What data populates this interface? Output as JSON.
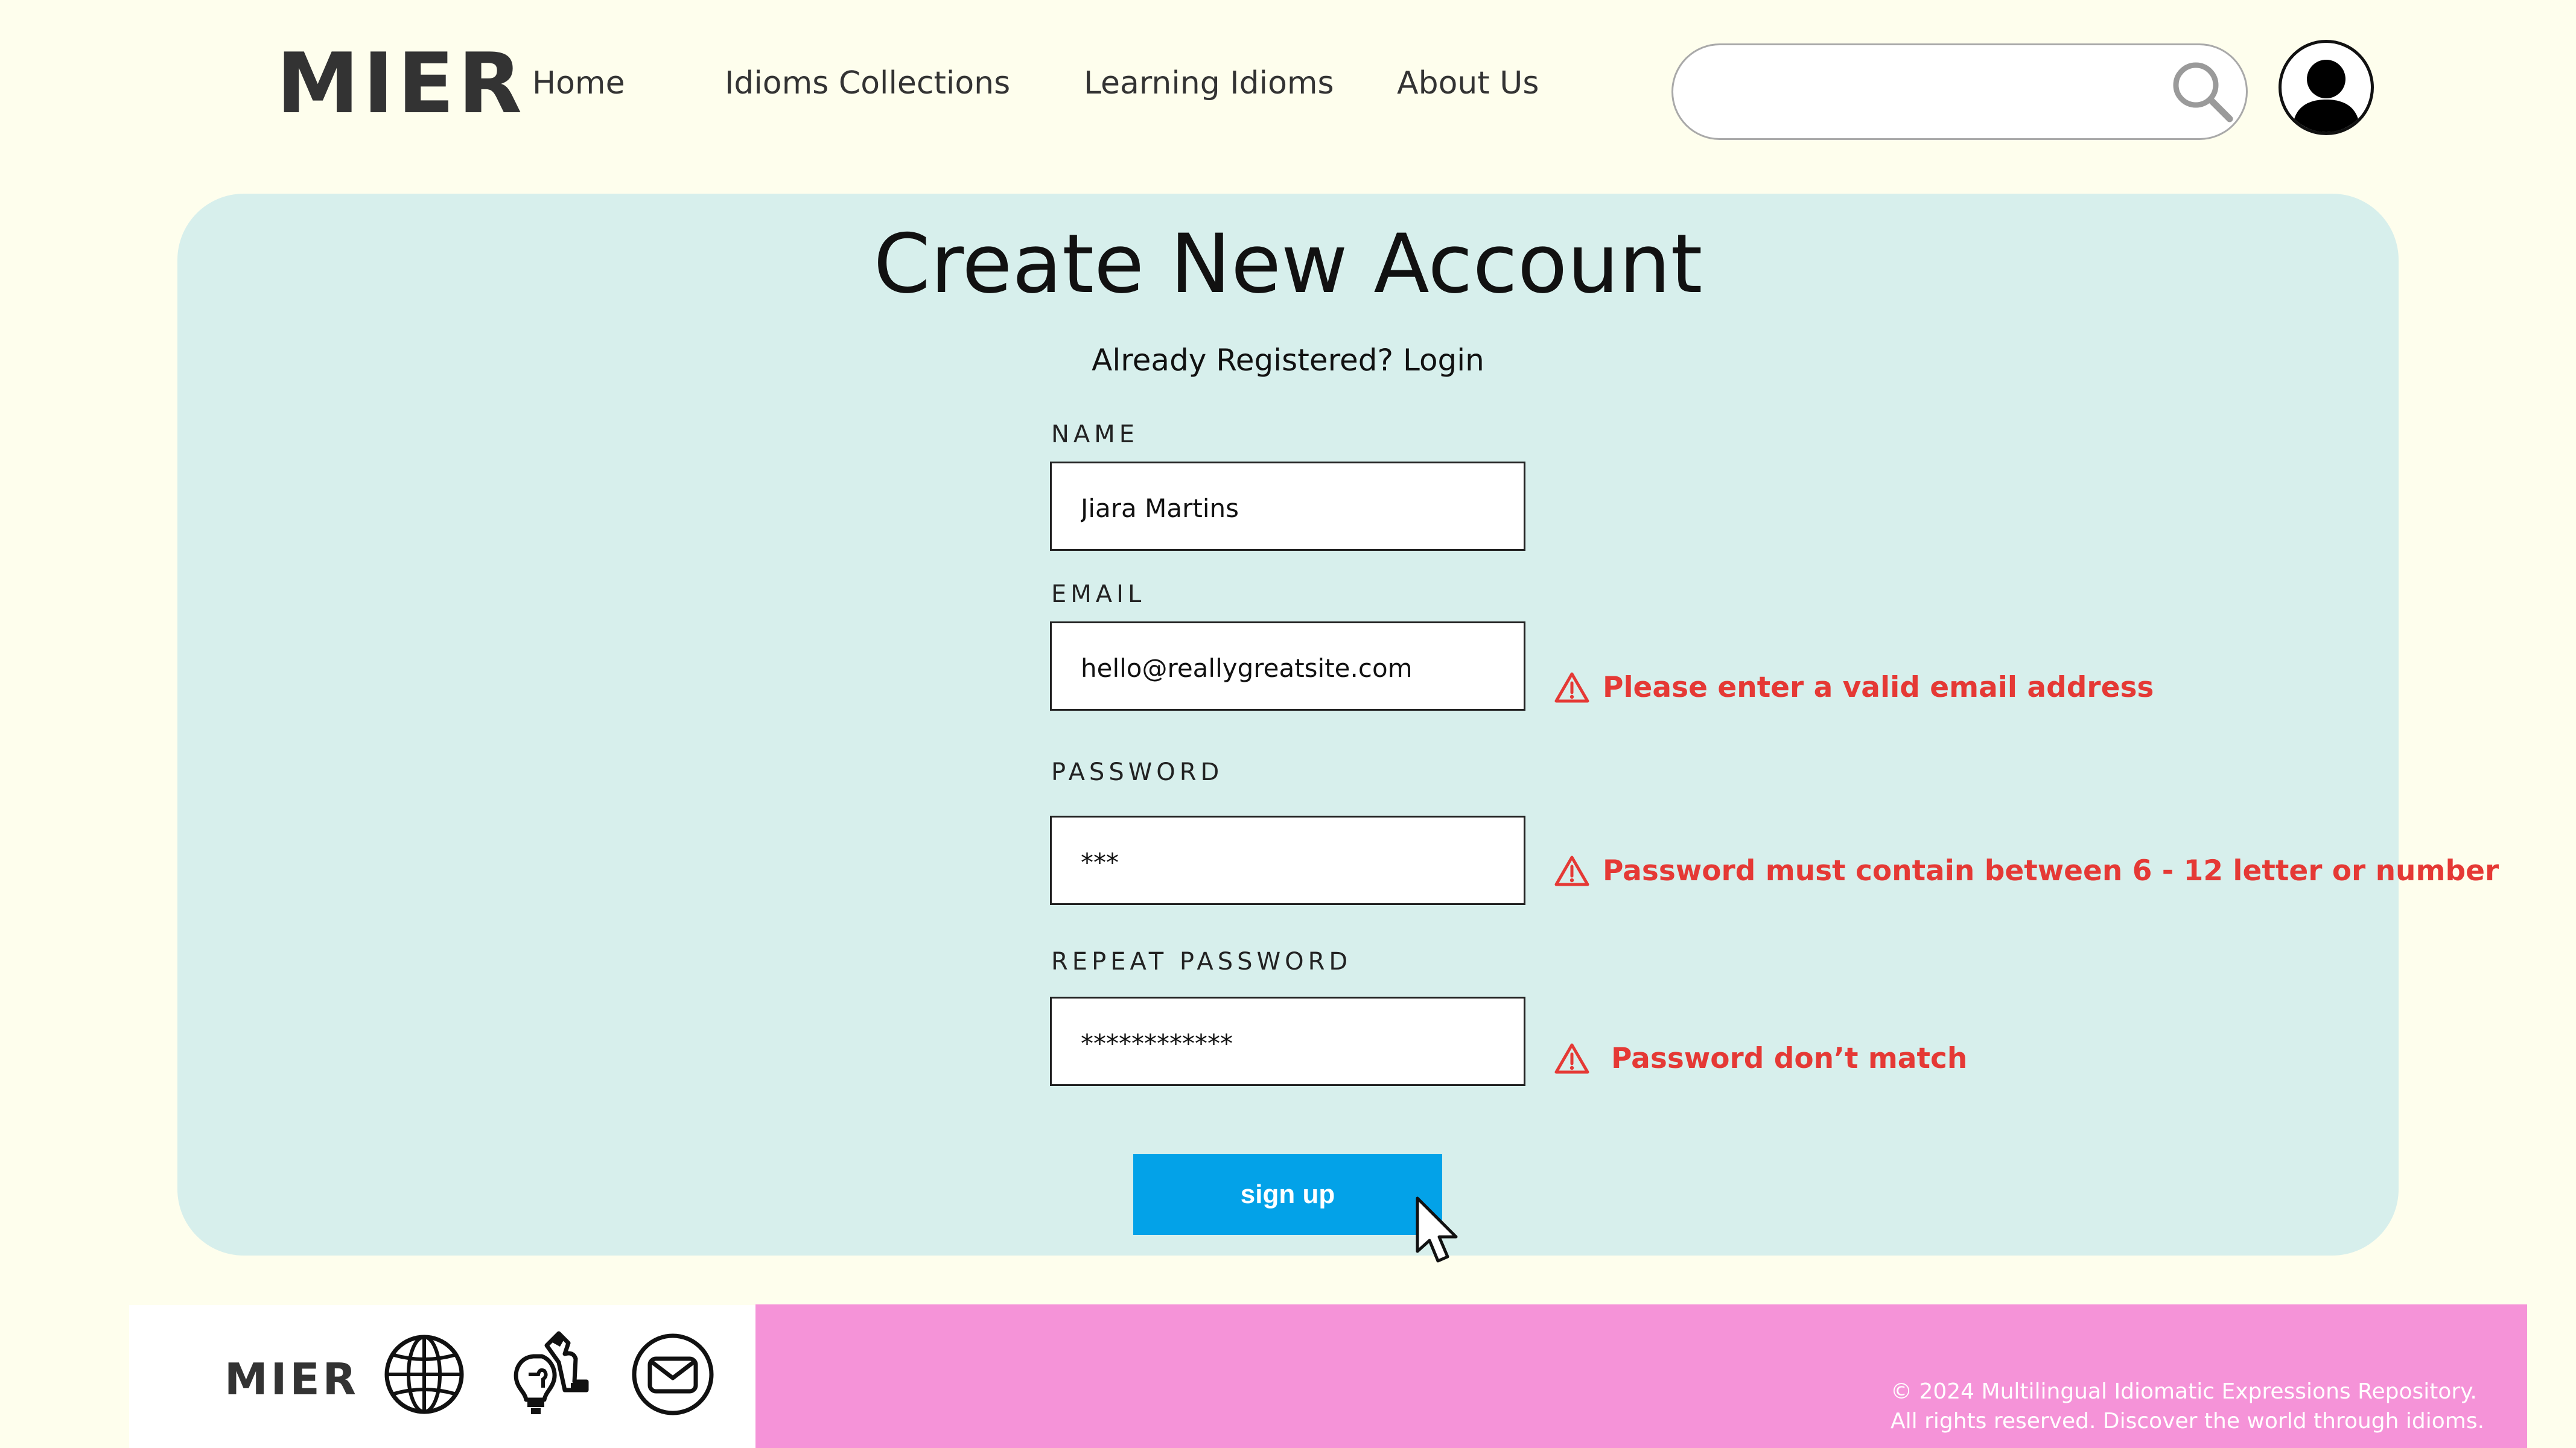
{
  "header": {
    "logo": "MIER",
    "nav": [
      {
        "label": "Home"
      },
      {
        "label": "Idioms Collections"
      },
      {
        "label": "Learning Idioms"
      },
      {
        "label": "About Us"
      }
    ],
    "search": {
      "value": "",
      "placeholder": "",
      "icon": "search-icon"
    },
    "profile_icon": "user-icon"
  },
  "form": {
    "title": "Create New Account",
    "subtitle_prefix": "Already Registered? ",
    "login_link": "Login",
    "fields": [
      {
        "label": "NAME",
        "value": "Jiara Martins",
        "error": ""
      },
      {
        "label": "EMAIL",
        "value": "hello@reallygreatsite.com",
        "error": "Please enter a valid email address"
      },
      {
        "label": "PASSWORD",
        "value": "***",
        "error": "Password must contain between 6 - 12  letter or number"
      },
      {
        "label": "REPEAT PASSWORD",
        "value": "************",
        "error": "Password don’t match"
      }
    ],
    "submit_label": "sign up"
  },
  "footer": {
    "logo": "MIER",
    "icons": [
      "globe-icon",
      "puzzle-lightbulb-icon",
      "mail-icon"
    ],
    "copyright_line1": "© 2024 Multilingual Idiomatic Expressions Repository.",
    "copyright_line2": "All rights reserved. Discover the world through idioms."
  },
  "colors": {
    "page_bg": "#fefeed",
    "card_bg": "#d7efec",
    "button_bg": "#03a2e8",
    "error": "#e53935",
    "footer_pink": "#f593d8"
  }
}
